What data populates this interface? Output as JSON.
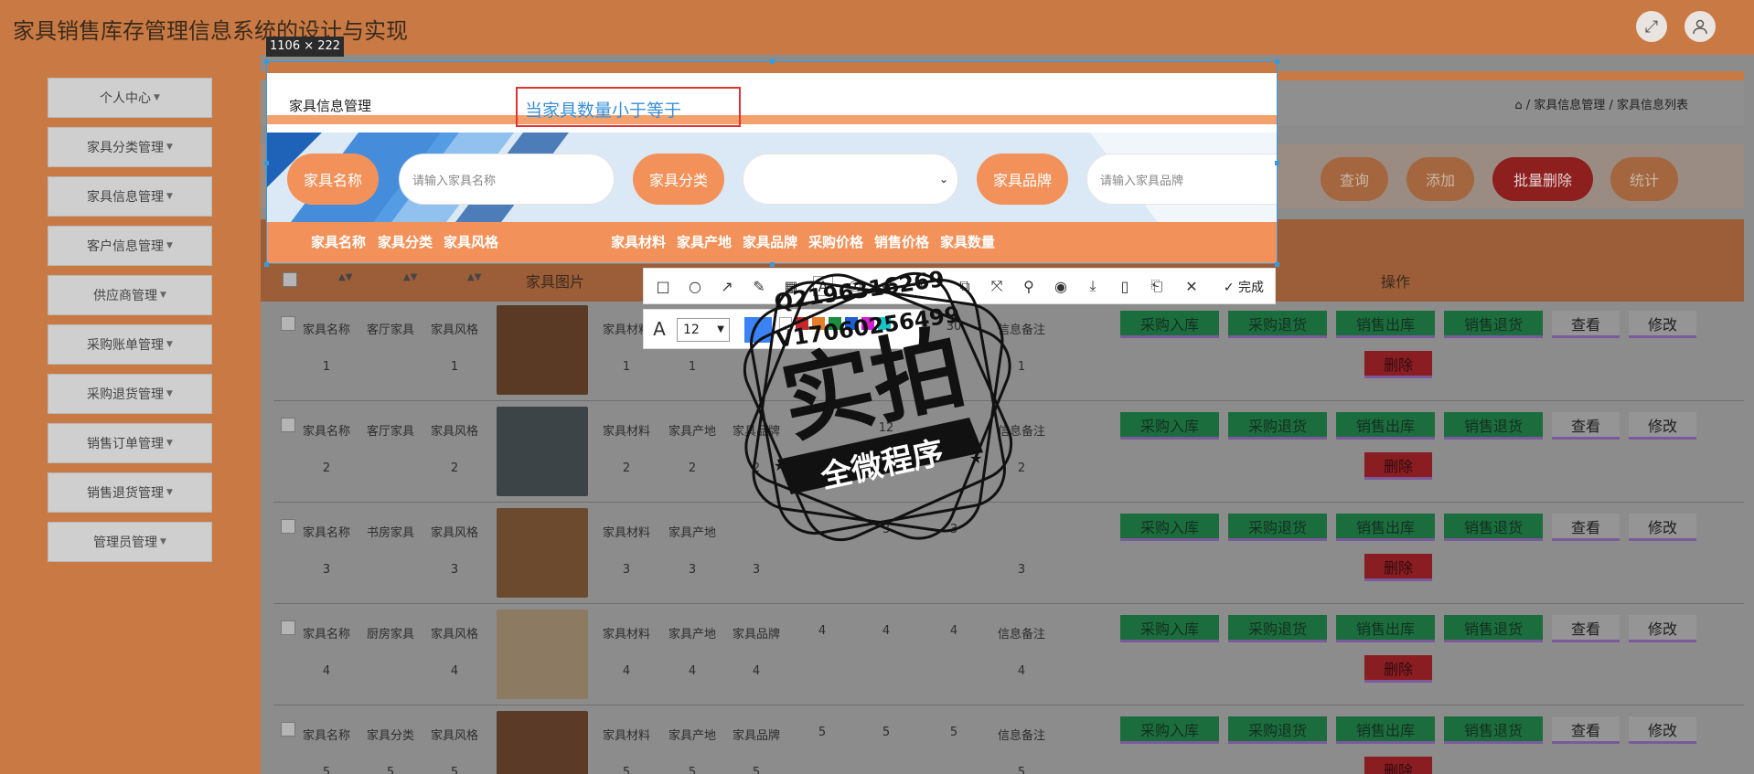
{
  "app": {
    "title": "家具销售库存管理信息系统的设计与实现"
  },
  "header": {
    "fullscreen_icon": "fullscreen-icon",
    "user_icon": "user-avatar-icon"
  },
  "sidebar": {
    "items": [
      {
        "label": "个人中心"
      },
      {
        "label": "家具分类管理"
      },
      {
        "label": "家具信息管理"
      },
      {
        "label": "客户信息管理"
      },
      {
        "label": "供应商管理"
      },
      {
        "label": "采购账单管理"
      },
      {
        "label": "采购退货管理"
      },
      {
        "label": "销售订单管理"
      },
      {
        "label": "销售退货管理"
      },
      {
        "label": "管理员管理"
      }
    ]
  },
  "page": {
    "section_title": "家具信息管理",
    "breadcrumb": [
      "家具信息管理",
      "家具信息列表"
    ],
    "breadcrumb_sep": "/"
  },
  "search": {
    "name_label": "家具名称",
    "name_placeholder": "请输入家具名称",
    "category_label": "家具分类",
    "brand_label": "家具品牌",
    "brand_placeholder": "请输入家具品牌",
    "query_button": "查询",
    "add_button": "添加",
    "batch_delete_button": "批量删除",
    "stats_button": "统计"
  },
  "table": {
    "headers": [
      "家具名称",
      "家具分类",
      "家具风格",
      "家具图片",
      "家具材料",
      "家具产地",
      "家具品牌",
      "采购价格",
      "销售价格",
      "家具数量",
      "操作"
    ],
    "header_overlay": [
      "家具名称",
      "家具分类",
      "家具风格",
      "家具材料",
      "家具产地",
      "家具品牌",
      "采购价格",
      "销售价格",
      "家具数量"
    ],
    "rows": [
      {
        "name": "家具名称",
        "category": "客厅家具",
        "style": "家具风格",
        "material": "家具材料",
        "origin": "家具产地",
        "brand": "家具品牌",
        "purchase": "",
        "sale": "",
        "qty": "30",
        "note": "信息备注",
        "v1": "1",
        "v2": "1",
        "v3": "1",
        "v4": "1",
        "v5": "1",
        "v6": "",
        "v7": "1",
        "thumb_color": "#5a3a24"
      },
      {
        "name": "家具名称",
        "category": "客厅家具",
        "style": "家具风格",
        "material": "家具材料",
        "origin": "家具产地",
        "brand": "家具品牌",
        "purchase": "",
        "sale": "12",
        "qty": "",
        "note": "信息备注",
        "v1": "2",
        "v2": "2",
        "v3": "2",
        "v4": "2",
        "v5": "2",
        "v6": "2",
        "v7": "2",
        "thumb_color": "#3d4448"
      },
      {
        "name": "家具名称",
        "category": "书房家具",
        "style": "家具风格",
        "material": "家具材料",
        "origin": "家具产地",
        "brand": "家具品牌",
        "purchase": "3",
        "sale": "3",
        "qty": "3",
        "note": "",
        "v1": "3",
        "v2": "3",
        "v3": "3",
        "v4": "3",
        "v5": "3",
        "v6": "3",
        "v7": "3",
        "thumb_color": "#6b4a2e"
      },
      {
        "name": "家具名称",
        "category": "厨房家具",
        "style": "家具风格",
        "material": "家具材料",
        "origin": "家具产地",
        "brand": "家具品牌",
        "purchase": "4",
        "sale": "4",
        "qty": "4",
        "note": "信息备注",
        "v1": "4",
        "v2": "4",
        "v3": "4",
        "v4": "4",
        "v5": "4",
        "v6": "4",
        "v7": "4",
        "thumb_color": "#8d7a62"
      },
      {
        "name": "家具名称",
        "category": "家具分类",
        "style": "家具风格",
        "material": "家具材料",
        "origin": "家具产地",
        "brand": "家具品牌",
        "purchase": "5",
        "sale": "5",
        "qty": "5",
        "note": "信息备注",
        "v1": "5",
        "v2": "5",
        "v3": "5",
        "v4": "5",
        "v5": "5",
        "v6": "5",
        "v7": "5",
        "thumb_color": "#5b3b27"
      }
    ],
    "actions": {
      "purchase_in": "采购入库",
      "purchase_return": "采购退货",
      "sale_out": "销售出库",
      "sale_return": "销售退货",
      "view": "查看",
      "edit": "修改",
      "delete": "删除"
    }
  },
  "capture": {
    "size_label": "1106 × 222",
    "text_annotation": "当家具数量小于等于",
    "font_size": "12",
    "done_label": "完成",
    "tools": [
      "rectangle-icon",
      "ellipse-icon",
      "arrow-icon",
      "pen-icon",
      "mosaic-icon",
      "text-icon",
      "number-icon",
      "undo-icon",
      "redo-icon",
      "ocr-icon",
      "translate-icon",
      "pin-icon",
      "record-icon",
      "download-icon",
      "phone-icon",
      "bookmark-icon",
      "close-icon",
      "check-icon"
    ],
    "swatches": [
      "#3b82f6",
      "#ffffff",
      "#c62828",
      "#e57e2b",
      "#1e8e3e",
      "#1e5fd8",
      "#d21fd2",
      "#19c6c6"
    ]
  },
  "watermark": {
    "line1": "Q2196316269",
    "line2": "V17060256499",
    "stamp_big": "实拍",
    "stamp_small": "全微程序"
  },
  "colors": {
    "accent": "#f2925a",
    "frame": "#c97a44",
    "danger": "#d9343a",
    "success": "#1fb35c"
  }
}
